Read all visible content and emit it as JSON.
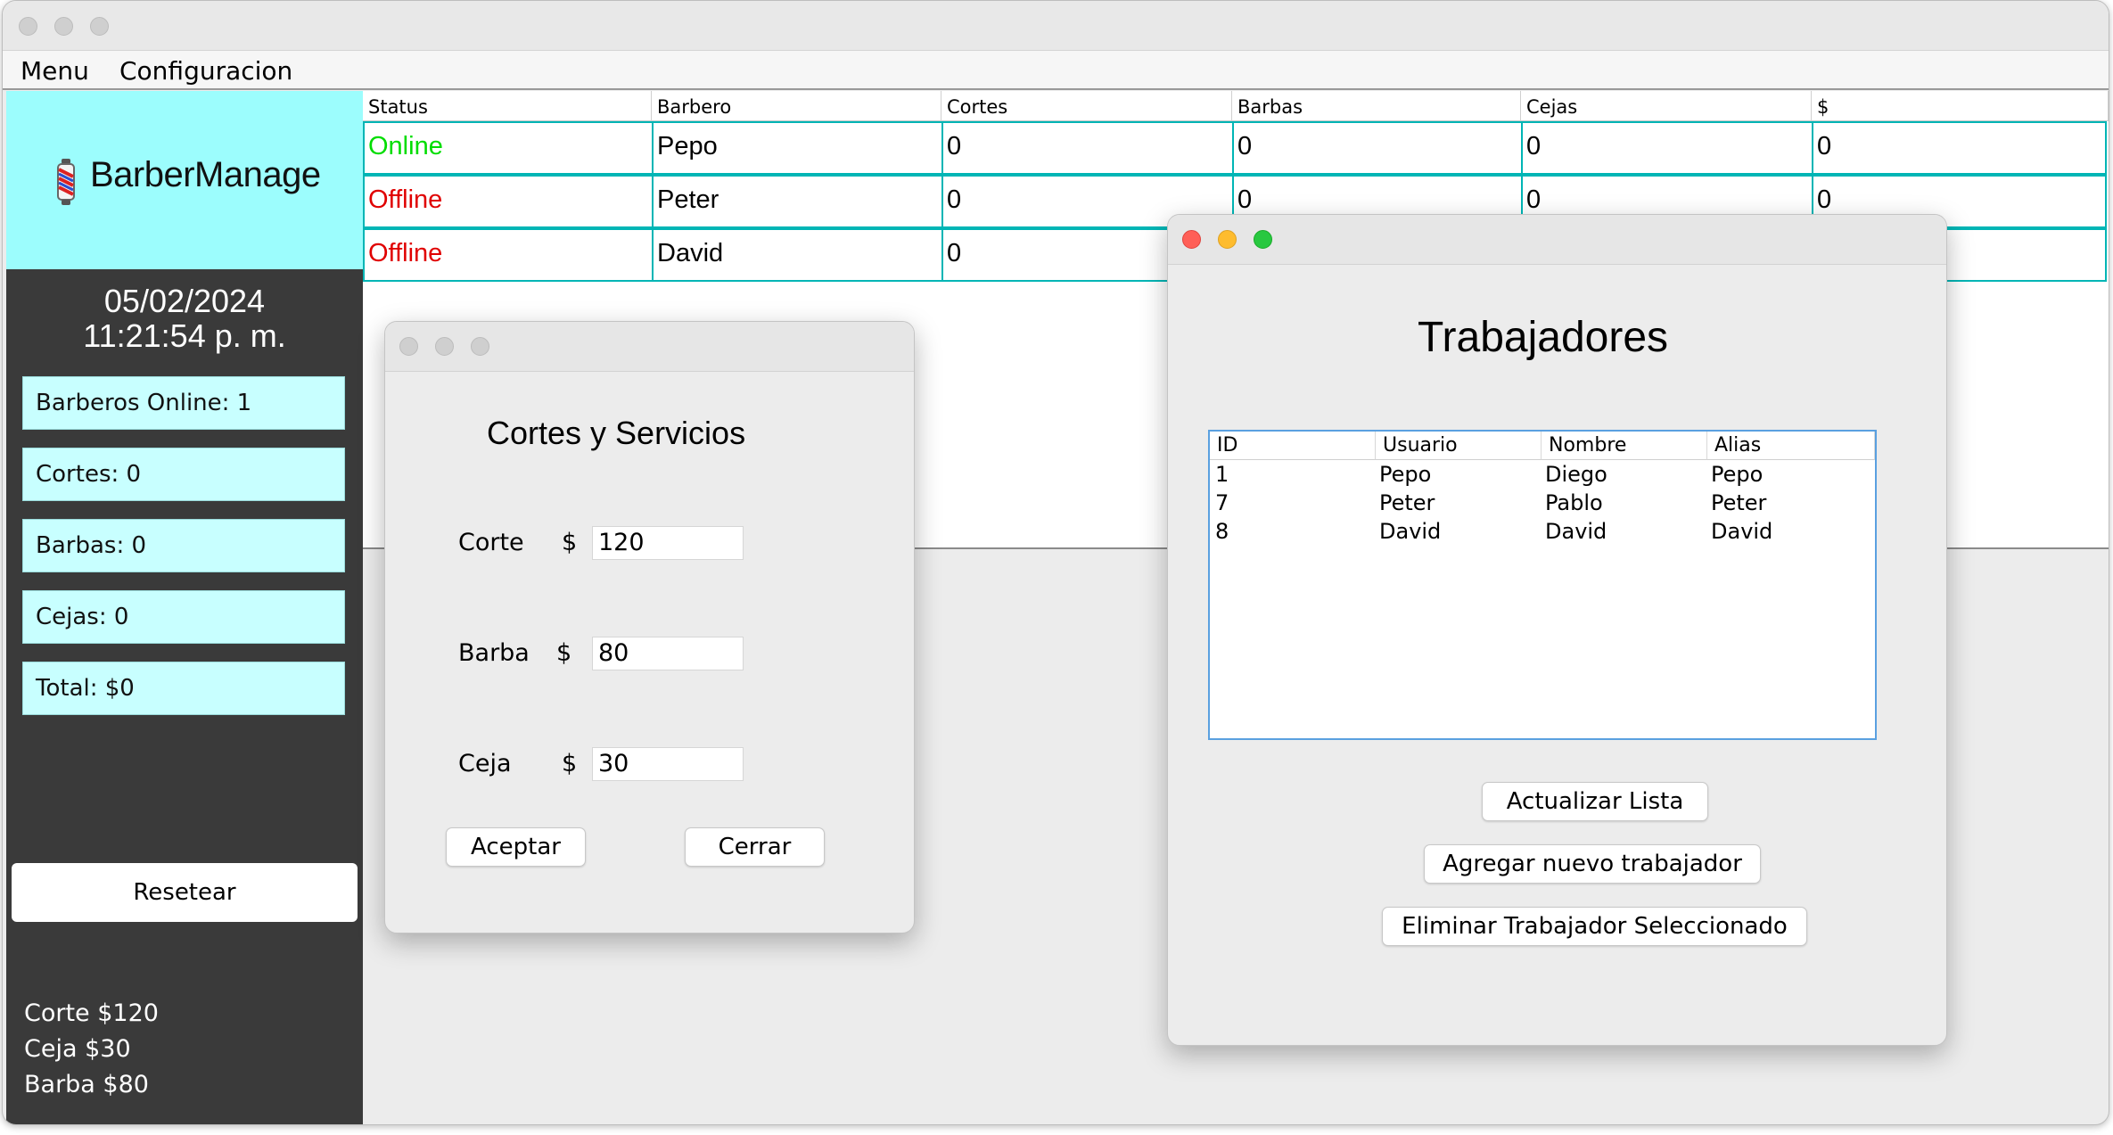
{
  "menubar": {
    "menu": "Menu",
    "config": "Configuracion"
  },
  "sidebar": {
    "logo_text": "BarberManage",
    "date": "05/02/2024",
    "time": "11:21:54 p. m.",
    "stats": {
      "online": "Barberos Online: 1",
      "cortes": "Cortes: 0",
      "barbas": "Barbas: 0",
      "cejas": "Cejas: 0",
      "total": "Total: $0"
    },
    "reset_label": "Resetear",
    "prices": {
      "corte": "Corte $120",
      "ceja": "Ceja $30",
      "barba": "Barba $80"
    }
  },
  "main_table": {
    "headers": [
      "Status",
      "Barbero",
      "Cortes",
      "Barbas",
      "Cejas",
      "$"
    ],
    "rows": [
      [
        "Online",
        "Pepo",
        "0",
        "0",
        "0",
        "0"
      ],
      [
        "Offline",
        "Peter",
        "0",
        "0",
        "0",
        "0"
      ],
      [
        "Offline",
        "David",
        "0",
        "",
        "",
        ""
      ]
    ]
  },
  "cortes_dialog": {
    "title": "Cortes y Servicios",
    "corte_label": "Corte",
    "barba_label": "Barba",
    "ceja_label": "Ceja",
    "currency": "$",
    "corte_value": "120",
    "barba_value": "80",
    "ceja_value": "30",
    "accept": "Aceptar",
    "close": "Cerrar"
  },
  "trabajadores_dialog": {
    "title": "Trabajadores",
    "headers": [
      "ID",
      "Usuario",
      "Nombre",
      "Alias"
    ],
    "rows": [
      [
        "1",
        "Pepo",
        "Diego",
        "Pepo"
      ],
      [
        "7",
        "Peter",
        "Pablo",
        "Peter"
      ],
      [
        "8",
        "David",
        "David",
        "David"
      ]
    ],
    "refresh": "Actualizar Lista",
    "add": "Agregar nuevo trabajador",
    "delete": "Eliminar Trabajador Seleccionado"
  },
  "colors": {
    "online": "#00dd00",
    "offline": "#e00000",
    "accent": "#9cfdfd",
    "grid": "#00b5b5"
  }
}
